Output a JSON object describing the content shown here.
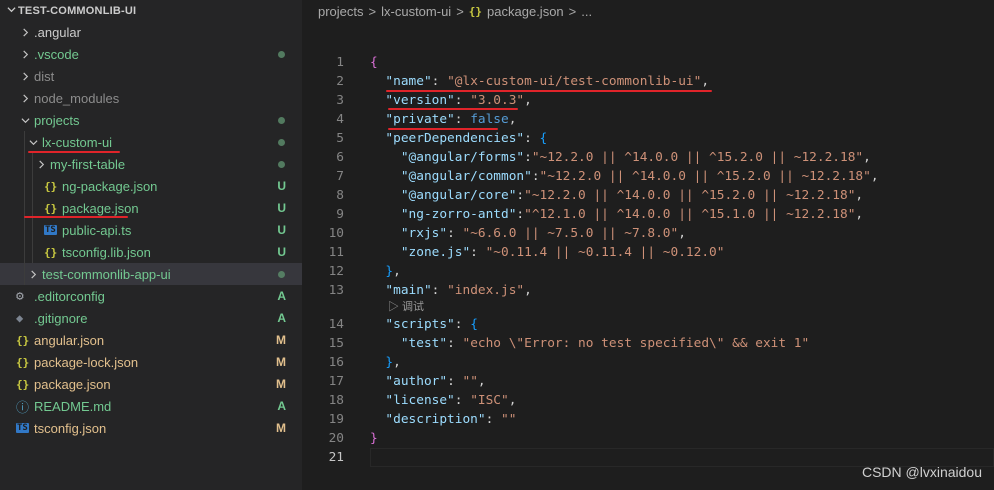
{
  "explorer": {
    "title": "TEST-COMMONLIB-UI",
    "items": [
      {
        "label": ".angular",
        "depth": 0,
        "type": "folder",
        "open": false,
        "status": "",
        "color": "white"
      },
      {
        "label": ".vscode",
        "depth": 0,
        "type": "folder",
        "open": false,
        "status": "dot",
        "color": "green"
      },
      {
        "label": "dist",
        "depth": 0,
        "type": "folder",
        "open": false,
        "status": "",
        "color": "gray"
      },
      {
        "label": "node_modules",
        "depth": 0,
        "type": "folder",
        "open": false,
        "status": "",
        "color": "gray"
      },
      {
        "label": "projects",
        "depth": 0,
        "type": "folder",
        "open": true,
        "status": "dot",
        "color": "green"
      },
      {
        "label": "lx-custom-ui",
        "depth": 1,
        "type": "folder",
        "open": true,
        "status": "dot",
        "color": "green"
      },
      {
        "label": "my-first-table",
        "depth": 2,
        "type": "folder",
        "open": false,
        "status": "dot",
        "color": "green"
      },
      {
        "label": "ng-package.json",
        "depth": 2,
        "type": "json",
        "status": "U",
        "color": "green"
      },
      {
        "label": "package.json",
        "depth": 2,
        "type": "json",
        "status": "U",
        "color": "green"
      },
      {
        "label": "public-api.ts",
        "depth": 2,
        "type": "ts",
        "status": "U",
        "color": "green"
      },
      {
        "label": "tsconfig.lib.json",
        "depth": 2,
        "type": "json",
        "status": "U",
        "color": "green"
      },
      {
        "label": "test-commonlib-app-ui",
        "depth": 1,
        "type": "folder",
        "open": false,
        "status": "dot",
        "color": "green",
        "active": true
      },
      {
        "label": ".editorconfig",
        "depth": 0,
        "type": "gear",
        "status": "A",
        "color": "green"
      },
      {
        "label": ".gitignore",
        "depth": 0,
        "type": "git",
        "status": "A",
        "color": "green"
      },
      {
        "label": "angular.json",
        "depth": 0,
        "type": "json",
        "status": "M",
        "color": "mod"
      },
      {
        "label": "package-lock.json",
        "depth": 0,
        "type": "json",
        "status": "M",
        "color": "mod"
      },
      {
        "label": "package.json",
        "depth": 0,
        "type": "json",
        "status": "M",
        "color": "mod"
      },
      {
        "label": "README.md",
        "depth": 0,
        "type": "info",
        "status": "A",
        "color": "green"
      },
      {
        "label": "tsconfig.json",
        "depth": 0,
        "type": "ts",
        "status": "M",
        "color": "mod"
      }
    ]
  },
  "breadcrumb": {
    "parts": [
      "projects",
      "lx-custom-ui",
      "package.json",
      "..."
    ],
    "separator": ">"
  },
  "codelens": "▷ 调试",
  "code_lines": [
    {
      "n": "1",
      "tokens": [
        [
          "brace",
          "{"
        ]
      ]
    },
    {
      "n": "2",
      "tokens": [
        [
          "ws",
          "  "
        ],
        [
          "key",
          "\"name\""
        ],
        [
          "punc",
          ": "
        ],
        [
          "str",
          "\"@lx-custom-ui/test-commonlib-ui\""
        ],
        [
          "punc",
          ","
        ]
      ]
    },
    {
      "n": "3",
      "tokens": [
        [
          "ws",
          "  "
        ],
        [
          "key",
          "\"version\""
        ],
        [
          "punc",
          ": "
        ],
        [
          "str",
          "\"3.0.3\""
        ],
        [
          "punc",
          ","
        ]
      ]
    },
    {
      "n": "4",
      "tokens": [
        [
          "ws",
          "  "
        ],
        [
          "key",
          "\"private\""
        ],
        [
          "punc",
          ": "
        ],
        [
          "bool",
          "false"
        ],
        [
          "punc",
          ","
        ]
      ]
    },
    {
      "n": "5",
      "tokens": [
        [
          "ws",
          "  "
        ],
        [
          "key",
          "\"peerDependencies\""
        ],
        [
          "punc",
          ": "
        ],
        [
          "brace2",
          "{"
        ]
      ]
    },
    {
      "n": "6",
      "tokens": [
        [
          "ws",
          "    "
        ],
        [
          "key",
          "\"@angular/forms\""
        ],
        [
          "punc",
          ":"
        ],
        [
          "str",
          "\"~12.2.0 || ^14.0.0 || ^15.2.0 || ~12.2.18\""
        ],
        [
          "punc",
          ","
        ]
      ]
    },
    {
      "n": "7",
      "tokens": [
        [
          "ws",
          "    "
        ],
        [
          "key",
          "\"@angular/common\""
        ],
        [
          "punc",
          ":"
        ],
        [
          "str",
          "\"~12.2.0 || ^14.0.0 || ^15.2.0 || ~12.2.18\""
        ],
        [
          "punc",
          ","
        ]
      ]
    },
    {
      "n": "8",
      "tokens": [
        [
          "ws",
          "    "
        ],
        [
          "key",
          "\"@angular/core\""
        ],
        [
          "punc",
          ":"
        ],
        [
          "str",
          "\"~12.2.0 || ^14.0.0 || ^15.2.0 || ~12.2.18\""
        ],
        [
          "punc",
          ","
        ]
      ]
    },
    {
      "n": "9",
      "tokens": [
        [
          "ws",
          "    "
        ],
        [
          "key",
          "\"ng-zorro-antd\""
        ],
        [
          "punc",
          ":"
        ],
        [
          "str",
          "\"^12.1.0 || ^14.0.0 || ^15.1.0 || ~12.2.18\""
        ],
        [
          "punc",
          ","
        ]
      ]
    },
    {
      "n": "10",
      "tokens": [
        [
          "ws",
          "    "
        ],
        [
          "key",
          "\"rxjs\""
        ],
        [
          "punc",
          ": "
        ],
        [
          "str",
          "\"~6.6.0 || ~7.5.0 || ~7.8.0\""
        ],
        [
          "punc",
          ","
        ]
      ]
    },
    {
      "n": "11",
      "tokens": [
        [
          "ws",
          "    "
        ],
        [
          "key",
          "\"zone.js\""
        ],
        [
          "punc",
          ": "
        ],
        [
          "str",
          "\"~0.11.4 || ~0.11.4 || ~0.12.0\""
        ]
      ]
    },
    {
      "n": "12",
      "tokens": [
        [
          "ws",
          "  "
        ],
        [
          "brace2",
          "}"
        ],
        [
          "punc",
          ","
        ]
      ]
    },
    {
      "n": "13",
      "tokens": [
        [
          "ws",
          "  "
        ],
        [
          "key",
          "\"main\""
        ],
        [
          "punc",
          ": "
        ],
        [
          "str",
          "\"index.js\""
        ],
        [
          "punc",
          ","
        ]
      ]
    },
    {
      "n": "14",
      "tokens": [
        [
          "ws",
          "  "
        ],
        [
          "key",
          "\"scripts\""
        ],
        [
          "punc",
          ": "
        ],
        [
          "brace2",
          "{"
        ]
      ]
    },
    {
      "n": "15",
      "tokens": [
        [
          "ws",
          "    "
        ],
        [
          "key",
          "\"test\""
        ],
        [
          "punc",
          ": "
        ],
        [
          "str",
          "\"echo \\\"Error: no test specified\\\" && exit 1\""
        ]
      ]
    },
    {
      "n": "16",
      "tokens": [
        [
          "ws",
          "  "
        ],
        [
          "brace2",
          "}"
        ],
        [
          "punc",
          ","
        ]
      ]
    },
    {
      "n": "17",
      "tokens": [
        [
          "ws",
          "  "
        ],
        [
          "key",
          "\"author\""
        ],
        [
          "punc",
          ": "
        ],
        [
          "str",
          "\"\""
        ],
        [
          "punc",
          ","
        ]
      ]
    },
    {
      "n": "18",
      "tokens": [
        [
          "ws",
          "  "
        ],
        [
          "key",
          "\"license\""
        ],
        [
          "punc",
          ": "
        ],
        [
          "str",
          "\"ISC\""
        ],
        [
          "punc",
          ","
        ]
      ]
    },
    {
      "n": "19",
      "tokens": [
        [
          "ws",
          "  "
        ],
        [
          "key",
          "\"description\""
        ],
        [
          "punc",
          ": "
        ],
        [
          "str",
          "\"\""
        ]
      ]
    },
    {
      "n": "20",
      "tokens": [
        [
          "brace",
          "}"
        ]
      ]
    },
    {
      "n": "21",
      "tokens": []
    }
  ],
  "current_line": "21",
  "watermark": "CSDN @lvxinaidou",
  "colors": {
    "accent_red_underline": "#e0242a",
    "untracked_green": "#73c991",
    "modified_yellow": "#e2c08d",
    "json_icon": "#cbcb41",
    "ts_icon": "#3178c6"
  }
}
